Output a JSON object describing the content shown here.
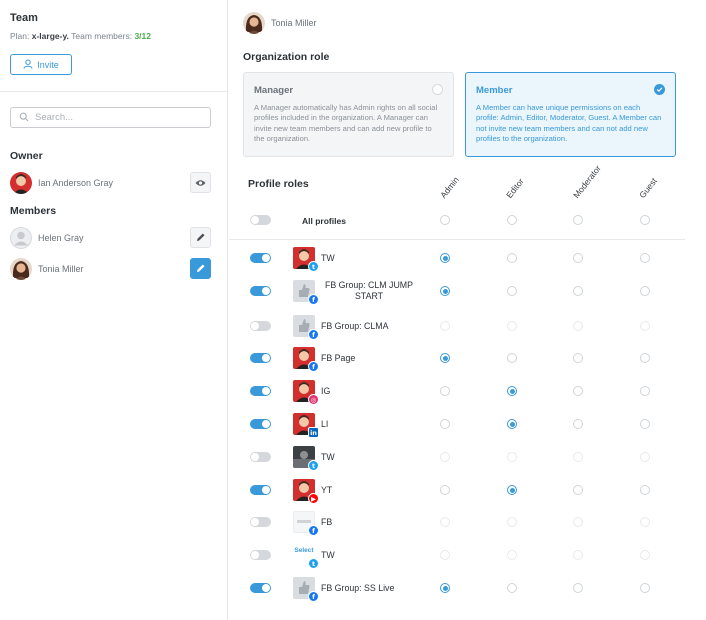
{
  "team": {
    "title": "Team",
    "plan_label": "Plan:",
    "plan_value": "x-large-y.",
    "members_label": "Team members:",
    "members_count": "3/12",
    "invite_label": "Invite"
  },
  "search": {
    "placeholder": "Search...",
    "value": ""
  },
  "sections": {
    "owner": "Owner",
    "members": "Members"
  },
  "owner": {
    "name": "Ian Anderson Gray",
    "action_icon": "eye-icon"
  },
  "members": [
    {
      "name": "Helen Gray",
      "action_icon": "pencil-icon",
      "active": false
    },
    {
      "name": "Tonia Miller",
      "action_icon": "pencil-icon",
      "active": true
    }
  ],
  "selected_member": {
    "name": "Tonia Miller"
  },
  "org_role": {
    "title": "Organization role",
    "selected": "member",
    "manager": {
      "title": "Manager",
      "description": "A Manager automatically has Admin rights on all social profiles included in the organization. A Manager can invite new team members and can add new profile to the organization."
    },
    "member": {
      "title": "Member",
      "description": "A Member can have unique permissions on each profile: Admin, Editor, Moderator, Guest. A Member can not invite new team members and can not add new profiles to the organization."
    }
  },
  "profile_roles": {
    "title": "Profile roles",
    "columns": [
      "Admin",
      "Editor",
      "Moderator",
      "Guest"
    ],
    "all_profiles_label": "All profiles",
    "rows": [
      {
        "name": "TW",
        "network": "twitter",
        "avatar": "red-person",
        "enabled": true,
        "role": "Admin"
      },
      {
        "name": "FB Group: CLM JUMP START",
        "network": "facebook",
        "avatar": "gray-thumb",
        "enabled": true,
        "role": "Admin"
      },
      {
        "name": "FB Group: CLMA",
        "network": "facebook",
        "avatar": "gray-thumb",
        "enabled": false,
        "role": null
      },
      {
        "name": "FB Page",
        "network": "facebook",
        "avatar": "red-person",
        "enabled": true,
        "role": "Admin"
      },
      {
        "name": "IG",
        "network": "instagram",
        "avatar": "red-person",
        "enabled": true,
        "role": "Editor"
      },
      {
        "name": "LI",
        "network": "linkedin",
        "avatar": "red-person",
        "enabled": true,
        "role": "Editor"
      },
      {
        "name": "TW",
        "network": "twitter",
        "avatar": "dark-photo",
        "enabled": false,
        "role": null
      },
      {
        "name": "YT",
        "network": "youtube",
        "avatar": "red-person",
        "enabled": true,
        "role": "Editor"
      },
      {
        "name": "FB",
        "network": "facebook",
        "avatar": "white-logo",
        "enabled": false,
        "role": null
      },
      {
        "name": "TW",
        "network": "twitter",
        "avatar": "select-logo",
        "avatar_text": "Select",
        "enabled": false,
        "role": null
      },
      {
        "name": "FB Group: SS Live",
        "network": "facebook",
        "avatar": "gray-thumb",
        "enabled": true,
        "role": "Admin"
      }
    ]
  },
  "colors": {
    "accent": "#3a9ad9",
    "count_green": "#4cae4f",
    "twitter": "#1da1f2",
    "facebook": "#1877f2",
    "instagram": "#e1306c",
    "linkedin": "#0a66c2",
    "youtube": "#ff0000"
  }
}
